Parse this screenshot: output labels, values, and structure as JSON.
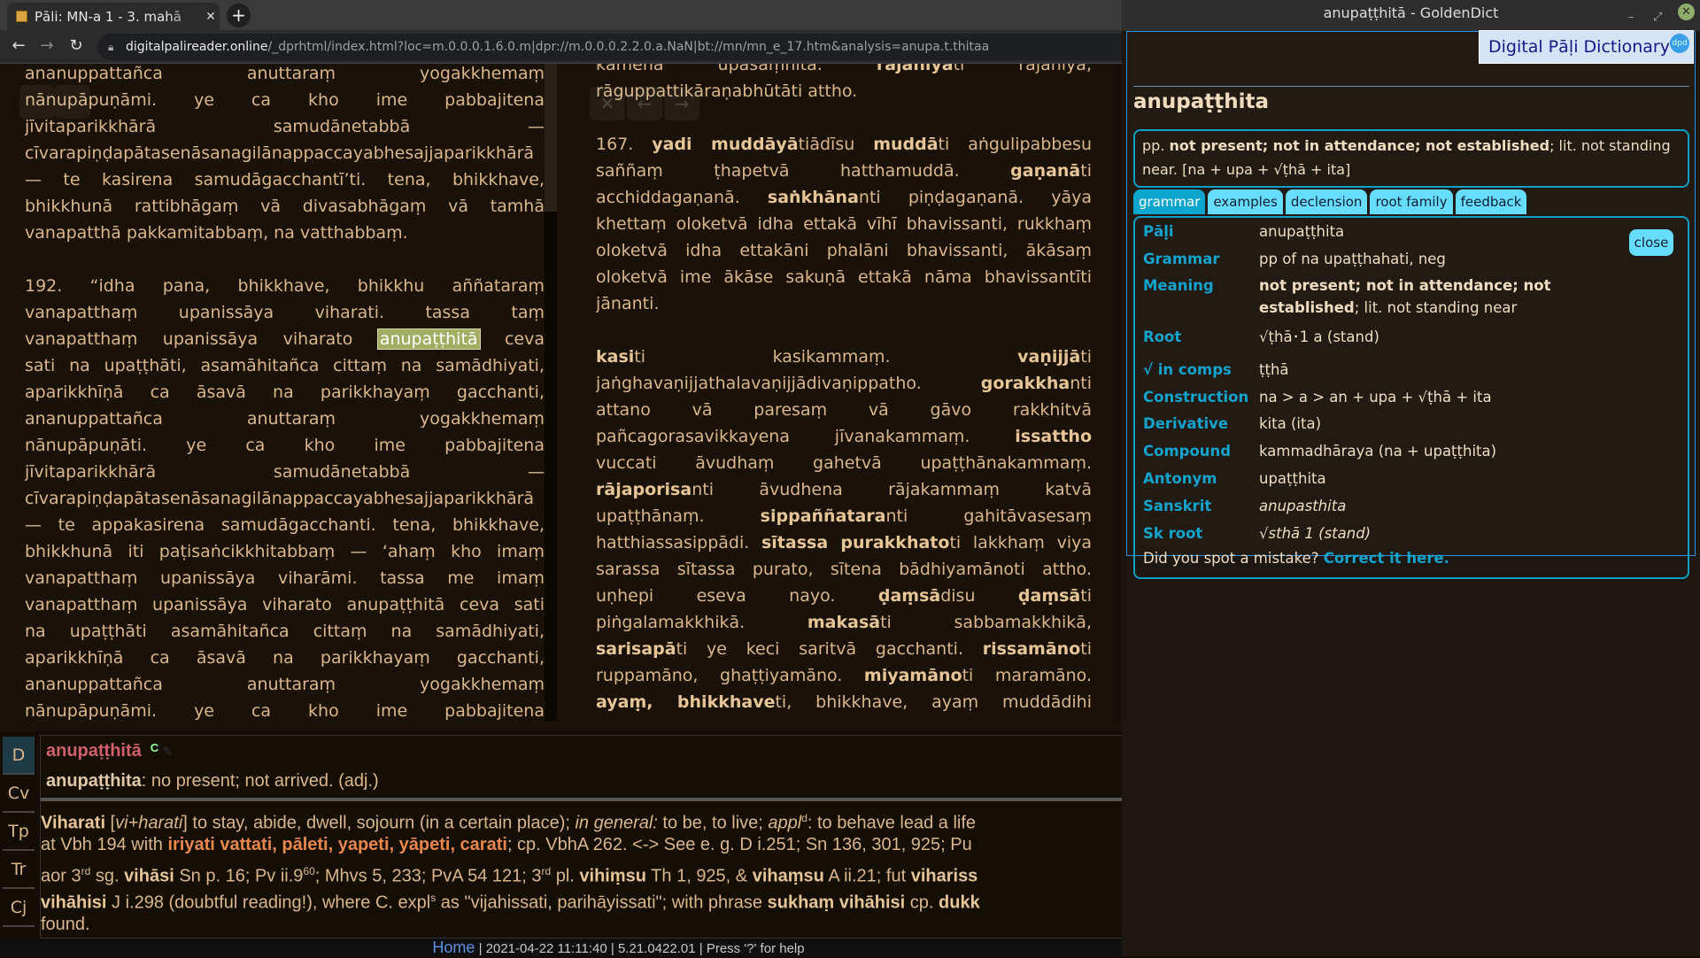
{
  "browser": {
    "tab_title": "Pāli: MN-a 1 - 3. mahā",
    "url_domain": "digitalpalireader.online",
    "url_path": "/_dprhtml/index.html?loc=m.0.0.0.1.6.0.m|dpr://m.0.0.0.2.2.0.a.NaN|bt://mn/mn_e_17.htm&analysis=anupa.t.thitaa"
  },
  "reader": {
    "left": [
      [
        [
          "ananuppattañca anuttaraṃ yogakkhemaṃ"
        ],
        [
          "nānupāpuṇāmi. ye ca kho ime pabbajitena"
        ],
        [
          "jīvitaparikkhārā samudānetabbā —"
        ],
        [
          "cīvarapiṇḍapātasenāsanagilānappaccayabhesajjaparikkhārā"
        ],
        [
          "— te kasirena samudāgacchantī’ti. tena, bhikkhave,"
        ],
        [
          "bhikkhunā rattibhāgaṃ vā divasabhāgaṃ vā tamhā"
        ],
        [
          "vanapatthā pakkamitabbaṃ, na vatthabbaṃ."
        ]
      ],
      [
        [
          "192. “idha pana, bhikkhave, bhikkhu aññataraṃ"
        ],
        [
          "vanapatthaṃ upanissāya viharati. tassa taṃ"
        ],
        [
          "vanapatthaṃ upanissāya viharato ",
          [
            "anupaṭṭhitā",
            "hl"
          ],
          " ceva"
        ],
        [
          "sati na upaṭṭhāti, asamāhitañca cittaṃ na samādhiyati,"
        ],
        [
          "aparikkhīṇā ca āsavā na parikkhayaṃ gacchanti,"
        ],
        [
          "ananuppattañca anuttaraṃ yogakkhemaṃ"
        ],
        [
          "nānupāpuṇāti. ye ca kho ime pabbajitena"
        ],
        [
          "jīvitaparikkhārā samudānetabbā —"
        ],
        [
          "cīvarapiṇḍapātasenāsanagilānappaccayabhesajjaparikkhārā"
        ],
        [
          "— te appakasirena samudāgacchanti. tena, bhikkhave,"
        ],
        [
          "bhikkhunā iti paṭisaṅcikkhitabbaṃ — ‘ahaṃ kho imaṃ"
        ],
        [
          "vanapatthaṃ upanissāya viharāmi. tassa me imaṃ"
        ],
        [
          "vanapatthaṃ upanissāya viharato anupaṭṭhitā ceva sati"
        ],
        [
          "na upaṭṭhāti asamāhitañca cittaṃ na samādhiyati,"
        ],
        [
          "aparikkhīṇā ca āsavā na parikkhayaṃ gacchanti,"
        ],
        [
          "ananuppattañca anuttaraṃ yogakkhemaṃ"
        ],
        [
          "nānupāpuṇāmi. ye ca kho ime pabbajitena"
        ]
      ]
    ],
    "right": [
      [
        [
          "kāmena upasaṃhitā. ",
          [
            "rajanīyā",
            "b"
          ],
          "ti rajanīyā,"
        ],
        [
          "rāguppattikāraṇabhūtāti attho."
        ]
      ],
      [
        [
          "167. ",
          [
            "yadi muddāyā",
            "b"
          ],
          "tiādīsu ",
          [
            "muddā",
            "b"
          ],
          "ti aṅgulipabbesu"
        ],
        [
          "saññaṃ ṭhapetvā hatthamuddā. ",
          [
            "gaṇanā",
            "b"
          ],
          "ti"
        ],
        [
          "acchiddagaṇanā. ",
          [
            "saṅkhāna",
            "b"
          ],
          "nti piṇḍagaṇanā. yāya"
        ],
        [
          "khettaṃ oloketvā idha ettakā vīhī bhavissanti, rukkhaṃ"
        ],
        [
          "oloketvā idha ettakāni phalāni bhavissanti, ākāsaṃ"
        ],
        [
          "oloketvā ime ākāse sakuṇā ettakā nāma bhavissantīti"
        ],
        [
          "jānanti."
        ]
      ],
      [
        [
          [
            "kasi",
            "b"
          ],
          "ti kasikammaṃ. ",
          [
            "vaṇijjā",
            "b"
          ],
          "ti"
        ],
        [
          "jaṅghavaṇijjathalavaṇijjādivaṇippatho. ",
          [
            "gorakkha",
            "b"
          ],
          "nti"
        ],
        [
          "attano vā paresaṃ vā gāvo rakkhitvā"
        ],
        [
          "pañcagorasavikkayena jīvanakammaṃ. ",
          [
            "issattho",
            "b"
          ]
        ],
        [
          "vuccati āvudhaṃ gahetvā upaṭṭhānakammaṃ."
        ],
        [
          [
            "rājaporisa",
            "b"
          ],
          "nti āvudhena rājakammaṃ katvā"
        ],
        [
          "upaṭṭhānaṃ. ",
          [
            "sippaññatara",
            "b"
          ],
          "nti gahitāvasesaṃ"
        ],
        [
          "hatthiassasippādi. ",
          [
            "sītassa purakkhato",
            "b"
          ],
          "ti lakkhaṃ viya"
        ],
        [
          "sarassa sītassa purato, sītena bādhiyamānoti attho."
        ],
        [
          "uṇhepi eseva nayo. ",
          [
            "ḍaṃsā",
            "b"
          ],
          "disu ",
          [
            "ḍaṃsā",
            "b"
          ],
          "ti"
        ],
        [
          "piṅgalamakkhikā. ",
          [
            "makasā",
            "b"
          ],
          "ti sabbamakkhikā,"
        ],
        [
          [
            "sarisapā",
            "b"
          ],
          "ti ye keci saritvā gacchanti. ",
          [
            "rissamāno",
            "b"
          ],
          "ti"
        ],
        [
          "ruppamāno, ghaṭṭiyamāno. ",
          [
            "miyamāno",
            "b"
          ],
          "ti maramāno."
        ],
        [
          [
            "ayaṃ, bhikkhave",
            "b"
          ],
          "ti, bhikkhave, ayaṃ muddādihi"
        ]
      ]
    ],
    "nav_buttons": {
      "close": "✕",
      "back": "←",
      "forward": "→"
    }
  },
  "bottom": {
    "side_tabs": [
      "D",
      "Cv",
      "Tp",
      "Tr",
      "Cj"
    ],
    "headword": "anupaṭṭhitā",
    "headword_tag": "C",
    "cpd_word": "anupaṭṭhita",
    "cpd_def": ": no present; not arrived. (adj.)",
    "ped_lines": [
      [
        [
          "Viharati",
          "b"
        ],
        " [",
        [
          "vi+harati",
          "i"
        ],
        "] to stay, abide, dwell, sojourn (in a certain place); ",
        [
          "in general:",
          "i"
        ],
        " to be, to live; ",
        [
          "appl",
          "i"
        ],
        [
          "d",
          "sup"
        ],
        [
          "",
          ""
        ],
        ": to behave lead a life"
      ],
      [
        "at Vbh 194 with ",
        [
          "iriyati vattati, pāleti, yapeti, yāpeti, carati",
          "o"
        ],
        "; cp. VbhA 262. <-> See e. g. D i.251; Sn 136, 301, 925; Pu"
      ],
      [
        "aor 3",
        [
          "rd",
          "sup"
        ],
        " sg. ",
        [
          "vihāsi",
          "b"
        ],
        " Sn p. 16; Pv ii.9",
        [
          "60",
          "sup"
        ],
        "; Mhvs 5, 233; PvA 54 121; 3",
        [
          "rd",
          "sup"
        ],
        " pl. ",
        [
          "vihiṃsu",
          "b"
        ],
        " Th 1, 925, & ",
        [
          "vihaṃsu",
          "b"
        ],
        " A ii.21; fut ",
        [
          "vihariss",
          "b"
        ]
      ],
      [
        [
          "vihāhisi",
          "b"
        ],
        " J i.298 (doubtful reading!), where C. expl",
        [
          "s",
          "sup"
        ],
        " as \"vijahissati, parihāyissati\"; with phrase ",
        [
          "sukhaṃ vihāhisi",
          "b"
        ],
        " cp. ",
        [
          "dukk",
          "b"
        ]
      ],
      [
        "found."
      ]
    ]
  },
  "footer": {
    "home": "Home",
    "sep": "|",
    "datetime": "2021-04-22 11:11:40",
    "version": "5.21.0422.01",
    "help": "Press '?' for help"
  },
  "goldendict": {
    "window_title": "anupaṭṭhitā - GoldenDict",
    "dict_name": "Digital Pāḷi Dictionary",
    "dict_logo": "dpd",
    "headword": "anupaṭṭhita",
    "summary_pos": "pp.",
    "summary_meaning": "not present; not in attendance; not established",
    "summary_rest": "; lit. not standing near. [na + upa + √ṭhā + ita]",
    "buttons": [
      "grammar",
      "examples",
      "declension",
      "root family",
      "feedback"
    ],
    "active_button": "grammar",
    "close_label": "close",
    "grammar": [
      {
        "label": "Pāḷi",
        "value": "anupaṭṭhita"
      },
      {
        "label": "Grammar",
        "value": "pp of na upaṭṭhahati, neg"
      },
      {
        "label": "Meaning",
        "value_bold1": "not present; not in attendance; not",
        "value_bold2": "established",
        "value_rest": "; lit. not standing near"
      },
      {
        "label": "Root",
        "value": "√ṭhā･1 a (stand)"
      },
      {
        "label": "√ in comps",
        "value": "ṭṭhā"
      },
      {
        "label": "Construction",
        "value": "na > a > an + upa + √ṭhā + ita"
      },
      {
        "label": "Derivative",
        "value": "kita (ita)"
      },
      {
        "label": "Compound",
        "value": "kammadhāraya (na + upaṭṭhita)"
      },
      {
        "label": "Antonym",
        "value": "upaṭṭhita"
      },
      {
        "label": "Sanskrit",
        "value": "anupasthita"
      },
      {
        "label": "Sk root",
        "value": "√sthā 1 (stand)"
      }
    ],
    "mistake_text": "Did you spot a mistake?",
    "mistake_link": "Correct it here.",
    "colors": {
      "label": "#14a3cc",
      "button": "#66dcff",
      "button_active": "#0ea5cf",
      "highlight": "#a3ad62",
      "headword_red": "#d0606a"
    }
  }
}
